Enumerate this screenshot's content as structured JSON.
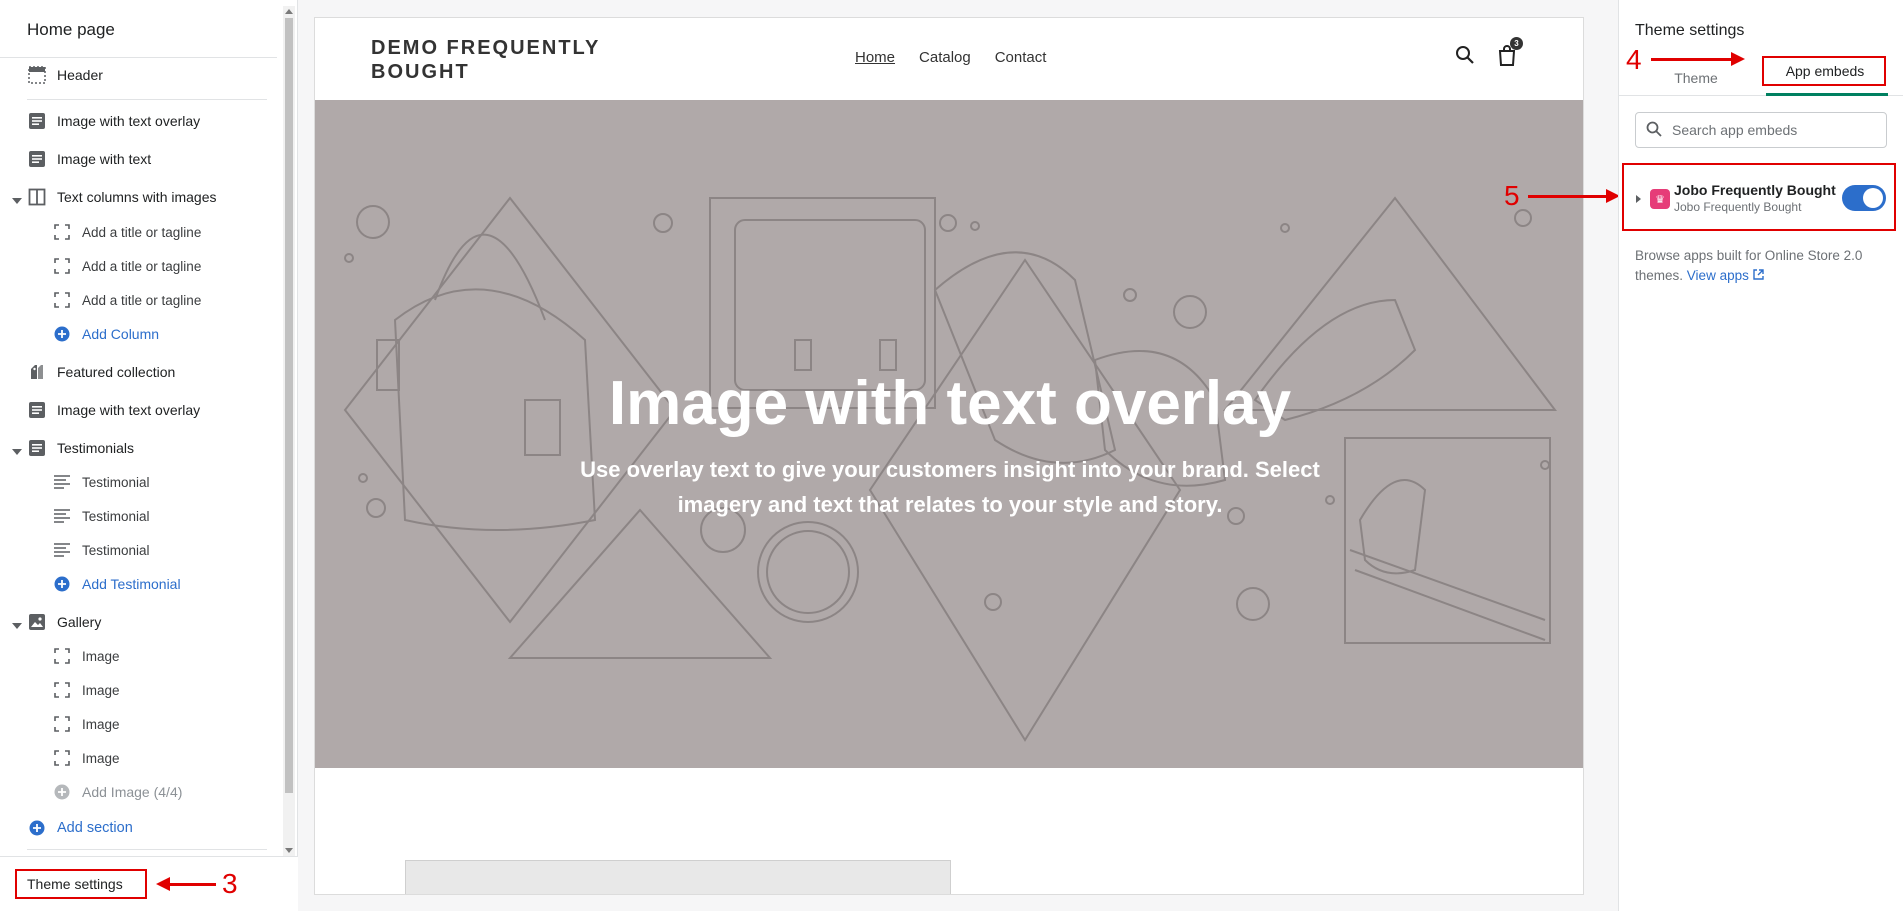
{
  "sidebar": {
    "title": "Home page",
    "items": [
      {
        "label": "Header"
      },
      {
        "label": "Image with text overlay"
      },
      {
        "label": "Image with text"
      },
      {
        "label": "Text columns with images"
      },
      {
        "label": "Add a title or tagline"
      },
      {
        "label": "Add a title or tagline"
      },
      {
        "label": "Add a title or tagline"
      },
      {
        "label": "Add Column"
      },
      {
        "label": "Featured collection"
      },
      {
        "label": "Image with text overlay"
      },
      {
        "label": "Testimonials"
      },
      {
        "label": "Testimonial"
      },
      {
        "label": "Testimonial"
      },
      {
        "label": "Testimonial"
      },
      {
        "label": "Add Testimonial"
      },
      {
        "label": "Gallery"
      },
      {
        "label": "Image"
      },
      {
        "label": "Image"
      },
      {
        "label": "Image"
      },
      {
        "label": "Image"
      },
      {
        "label": "Add Image (4/4)"
      },
      {
        "label": "Add section"
      }
    ],
    "footer_button": "Theme settings"
  },
  "annotations": {
    "step3": "3",
    "step4": "4",
    "step5": "5"
  },
  "preview": {
    "logo": "DEMO FREQUENTLY BOUGHT",
    "nav": [
      "Home",
      "Catalog",
      "Contact"
    ],
    "cart_count": "3",
    "hero_title": "Image with text overlay",
    "hero_text": "Use overlay text to give your customers insight into your brand. Select imagery and text that relates to your style and story."
  },
  "right_panel": {
    "title": "Theme settings",
    "tabs": [
      "Theme",
      "App embeds"
    ],
    "active_tab": "App embeds",
    "search_placeholder": "Search app embeds",
    "app": {
      "name": "Jobo Frequently Bought",
      "subtitle": "Jobo Frequently Bought",
      "enabled": true
    },
    "note_text": "Browse apps built for Online Store 2.0 themes.",
    "note_link": "View apps"
  },
  "colors": {
    "accent_blue": "#2c6ecb",
    "annotation_red": "#e00000",
    "tab_underline": "#008060",
    "hero_bg": "#b0a9a9"
  }
}
